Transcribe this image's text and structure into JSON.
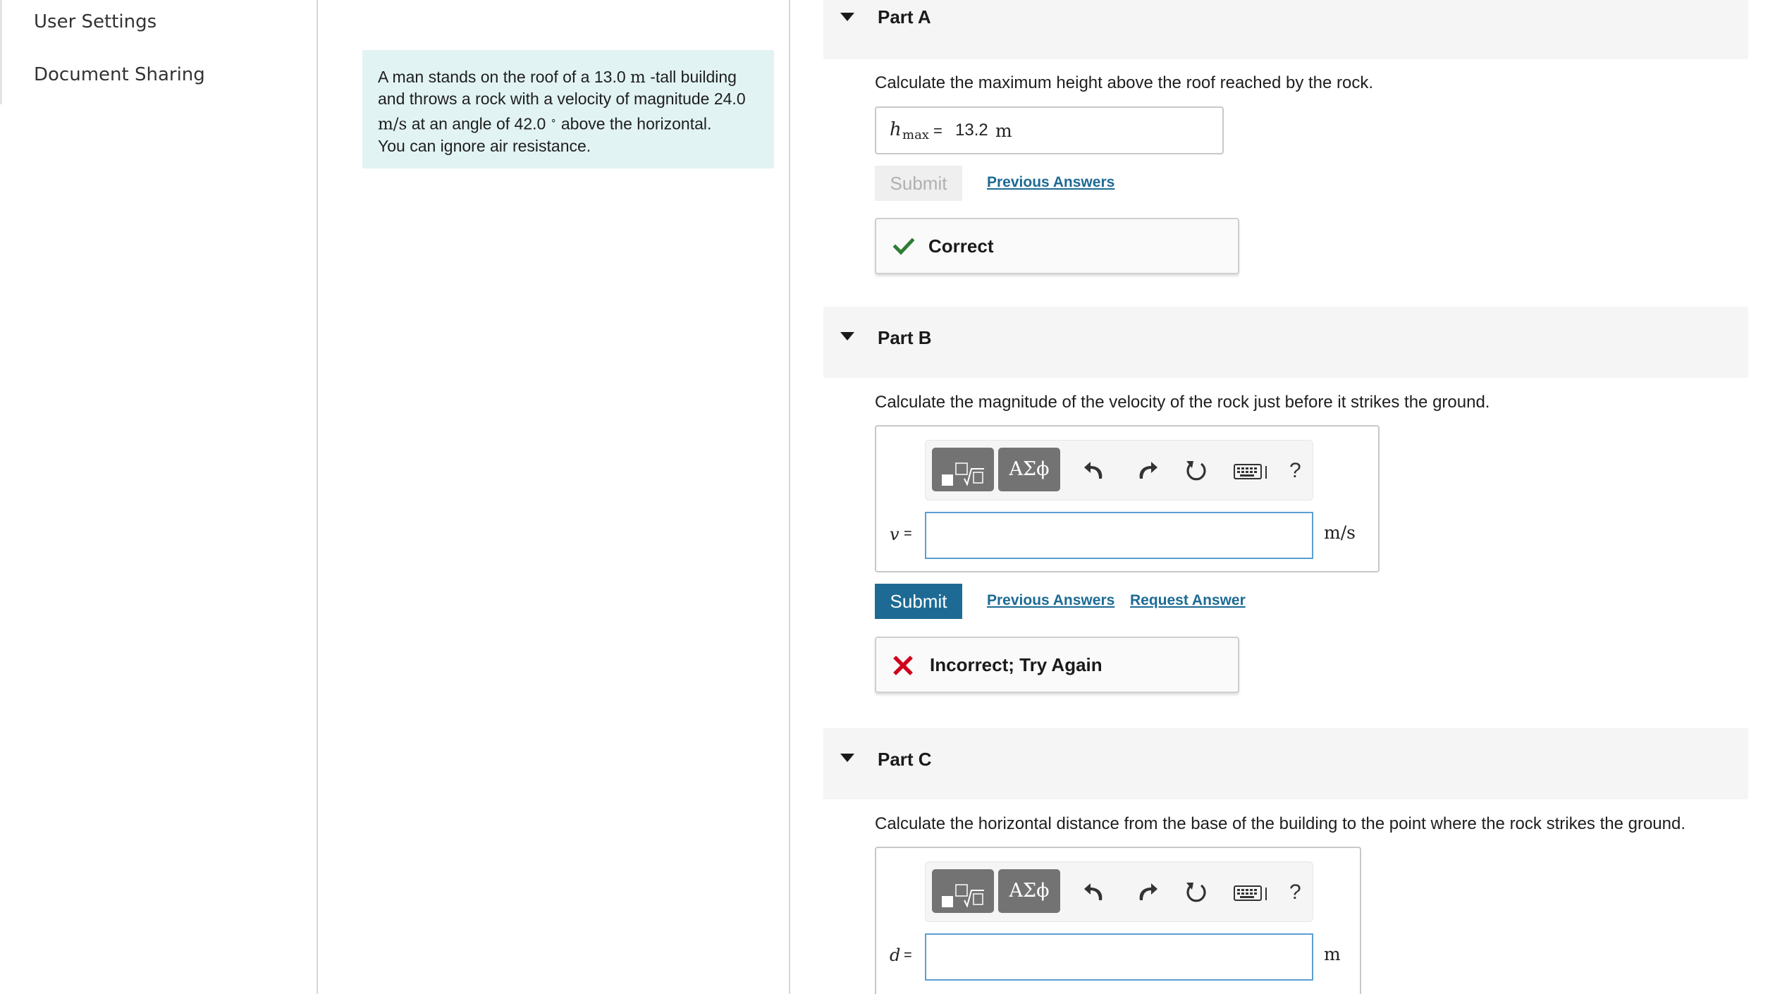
{
  "sidebar": {
    "items": [
      {
        "label": "User Settings"
      },
      {
        "label": "Document Sharing"
      }
    ]
  },
  "problem": {
    "line1_pre": "A man stands on the roof of a 13.0 ",
    "line1_unit": "m",
    "line1_post": " -tall building",
    "line2": "and throws a rock with a velocity of magnitude 24.0",
    "line3_unit": "m/s",
    "line3_post": " at an angle of 42.0 ",
    "line3_deg": "∘",
    "line3_end": " above the horizontal.",
    "line4": "You can ignore air resistance."
  },
  "parts": [
    {
      "title": "Part A",
      "question": "Calculate the maximum height above the roof reached by the rock.",
      "variable": "h",
      "variable_sub": "max",
      "equals": "=",
      "value": "13.2",
      "unit": "m",
      "submit_label": "Submit",
      "submit_state": "disabled",
      "links": [
        "Previous Answers"
      ],
      "feedback": "Correct",
      "feedback_status": "correct"
    },
    {
      "title": "Part B",
      "question": "Calculate the magnitude of the velocity of the rock just before it strikes the ground.",
      "toolbar": {
        "templates_icon": "templates-icon",
        "symbols_label": "ΑΣϕ",
        "help_label": "?"
      },
      "variable": "v",
      "equals": "=",
      "value": "",
      "unit": "m/s",
      "submit_label": "Submit",
      "submit_state": "active",
      "links": [
        "Previous Answers",
        "Request Answer"
      ],
      "feedback": "Incorrect; Try Again",
      "feedback_status": "incorrect"
    },
    {
      "title": "Part C",
      "question": "Calculate the horizontal distance from the base of the building to the point where the rock strikes the ground.",
      "toolbar": {
        "templates_icon": "templates-icon",
        "symbols_label": "ΑΣϕ",
        "help_label": "?"
      },
      "variable": "d",
      "equals": "=",
      "value": "",
      "unit": "m"
    }
  ],
  "colors": {
    "accent": "#1d6b94",
    "correct": "#2e7d32",
    "incorrect": "#d0021b",
    "problem_bg": "#e2f3f3"
  }
}
